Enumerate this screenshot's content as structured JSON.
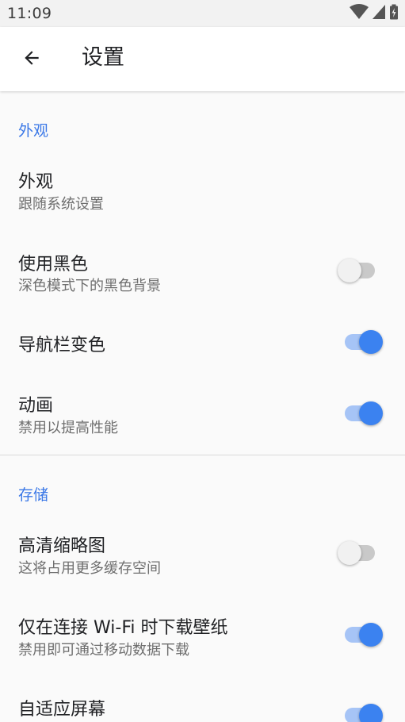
{
  "status_bar": {
    "time": "11:09",
    "icons": [
      "wifi-icon",
      "cell-signal-icon",
      "battery-charging-icon"
    ]
  },
  "app_bar": {
    "back_icon": "arrow-back-icon",
    "title": "设置"
  },
  "colors": {
    "accent": "#3b78e7",
    "switch_on_thumb": "#3b82f0",
    "switch_on_track": "#a6c4f6",
    "switch_off_thumb": "#f1f1f1",
    "switch_off_track": "#c9c9c9"
  },
  "sections": [
    {
      "header": "外观",
      "items": [
        {
          "title": "外观",
          "subtitle": "跟随系统设置"
        },
        {
          "title": "使用黑色",
          "subtitle": "深色模式下的黑色背景",
          "switch_on": false
        },
        {
          "title": "导航栏变色",
          "switch_on": true
        },
        {
          "title": "动画",
          "subtitle": "禁用以提高性能",
          "switch_on": true
        }
      ]
    },
    {
      "header": "存储",
      "items": [
        {
          "title": "高清缩略图",
          "subtitle": "这将占用更多缓存空间",
          "switch_on": false
        },
        {
          "title": "仅在连接 Wi-Fi 时下载壁纸",
          "subtitle": "禁用即可通过移动数据下载",
          "switch_on": true
        },
        {
          "title": "自适应屏幕",
          "switch_on": true
        }
      ]
    }
  ]
}
